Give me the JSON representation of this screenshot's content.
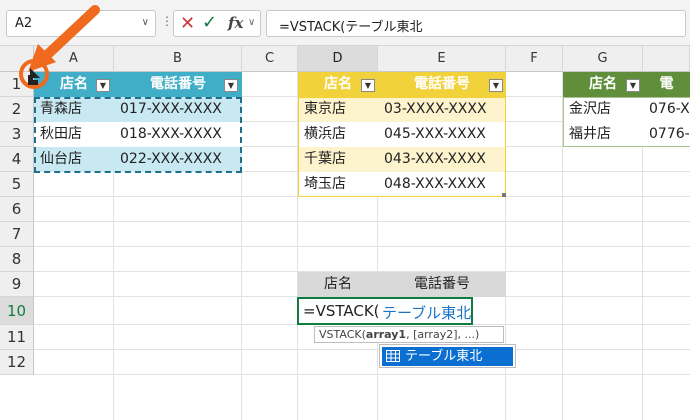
{
  "formula_bar": {
    "name_box": "A2",
    "name_box_arrow": "∨",
    "dots": "⋮",
    "cancel_icon": "✕",
    "enter_icon": "✓",
    "fx_icon": "fx",
    "fx_chevron": "∨",
    "formula": "=VSTACK(テーブル東北"
  },
  "columns": [
    "A",
    "B",
    "C",
    "D",
    "E",
    "F",
    "G"
  ],
  "rows": [
    "1",
    "2",
    "3",
    "4",
    "5",
    "6",
    "7",
    "8",
    "9",
    "10",
    "11",
    "12"
  ],
  "table_tohoku": {
    "headers": [
      "店名",
      "電話番号"
    ],
    "rows": [
      [
        "青森店",
        "017-XXX-XXXX"
      ],
      [
        "秋田店",
        "018-XXX-XXXX"
      ],
      [
        "仙台店",
        "022-XXX-XXXX"
      ]
    ],
    "header_color": "#3faec6",
    "band_color": "#c8e8f2"
  },
  "table_kanto": {
    "headers": [
      "店名",
      "電話番号"
    ],
    "rows": [
      [
        "東京店",
        "03-XXXX-XXXX"
      ],
      [
        "横浜店",
        "045-XXX-XXXX"
      ],
      [
        "千葉店",
        "043-XXX-XXXX"
      ],
      [
        "埼玉店",
        "048-XXX-XXXX"
      ]
    ],
    "header_color": "#f2d23a",
    "band_color": "#fdf3cc"
  },
  "table_hokuriku": {
    "headers": [
      "店名",
      "電"
    ],
    "rows": [
      [
        "金沢店",
        "076-X"
      ],
      [
        "福井店",
        "0776-"
      ]
    ],
    "header_color": "#5f8f3a"
  },
  "result_header": [
    "店名",
    "電話番号"
  ],
  "editing_cell": {
    "prefix": "=VSTACK(",
    "arg": "テーブル東北"
  },
  "tooltip": {
    "fn": "VSTACK(",
    "arg1": "array1",
    "rest": ", [array2], ...)"
  },
  "autocomplete": {
    "item": "テーブル東北"
  },
  "accent_green": "#107c41",
  "arrow_color": "#f06a1e"
}
